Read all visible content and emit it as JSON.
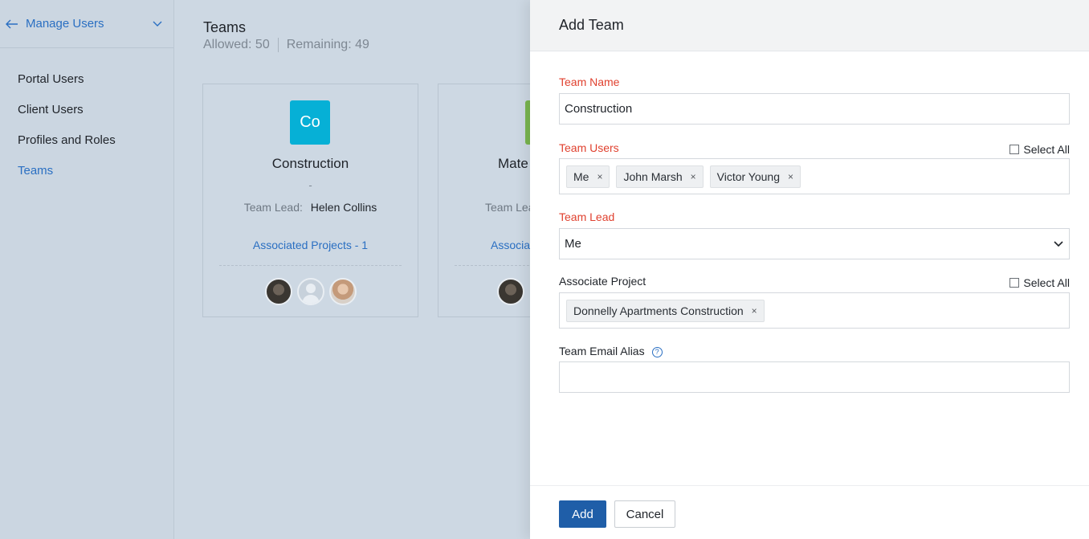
{
  "sidebar": {
    "title": "Manage Users",
    "items": [
      {
        "label": "Portal Users"
      },
      {
        "label": "Client Users"
      },
      {
        "label": "Profiles and Roles"
      },
      {
        "label": "Teams"
      }
    ]
  },
  "teams": {
    "title": "Teams",
    "allowed": "Allowed: 50",
    "remaining": "Remaining: 49",
    "cards": [
      {
        "initials": "Co",
        "name": "Construction",
        "description": "-",
        "lead_label": "Team Lead:",
        "lead_value": "Helen Collins",
        "projects": "Associated Projects - 1",
        "color": "#06b0d6"
      },
      {
        "name": "Mate",
        "lead_label": "Team Lea",
        "projects": "Associat",
        "color": "#79b54f"
      }
    ]
  },
  "drawer": {
    "title": "Add Team",
    "team_name_label": "Team Name",
    "team_name_value": "Construction",
    "team_users_label": "Team Users",
    "select_all": "Select All",
    "team_users": [
      "Me",
      "John Marsh",
      "Victor Young"
    ],
    "team_lead_label": "Team Lead",
    "team_lead_value": "Me",
    "associate_project_label": "Associate Project",
    "projects": [
      "Donnelly Apartments Construction"
    ],
    "email_alias_label": "Team Email Alias",
    "email_alias_value": "",
    "add_button": "Add",
    "cancel_button": "Cancel",
    "tag_remove": "×",
    "help_glyph": "?"
  },
  "colors": {
    "accent": "#2a6fc2",
    "required": "#e0412f",
    "primary_button": "#1f5ea8"
  }
}
